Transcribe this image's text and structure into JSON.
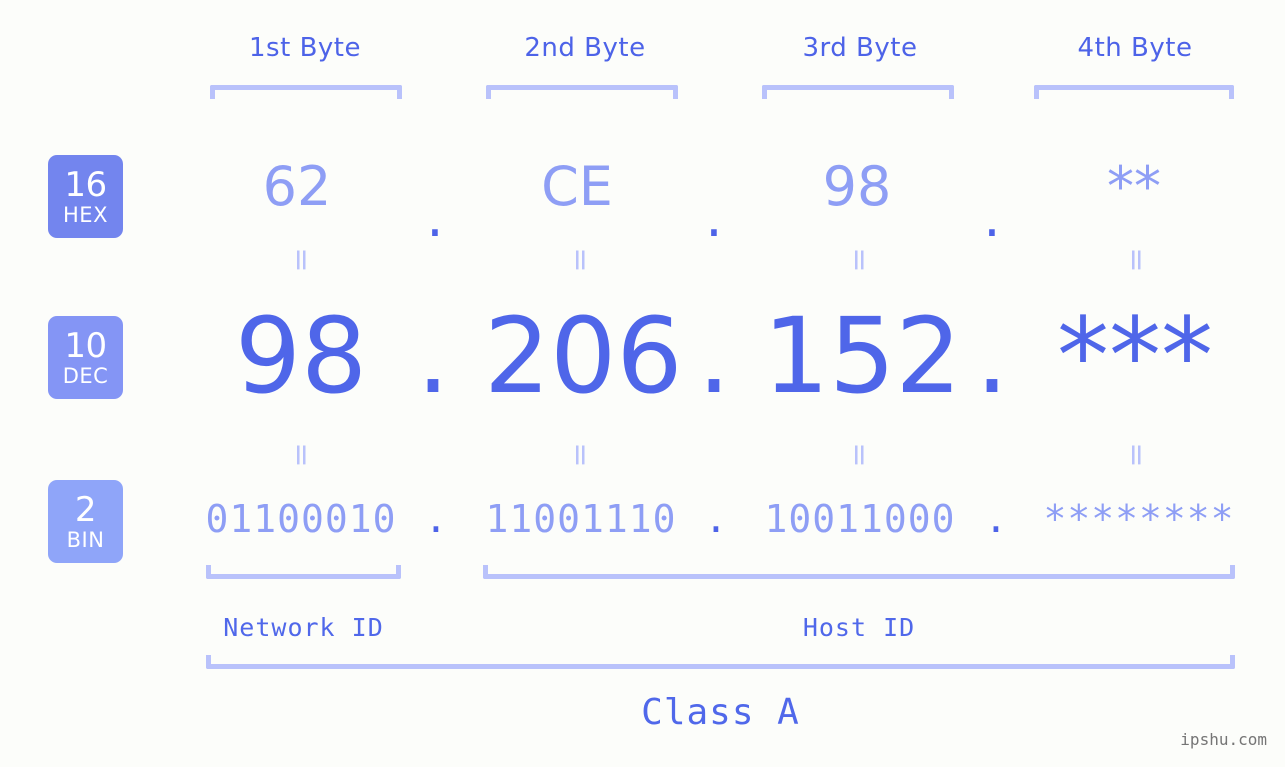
{
  "meta": {
    "background_color": "#fcfdfa",
    "accent_strong": "#4f66e9",
    "accent_light": "#8e9ef5",
    "bracket_color": "#b9c2fb",
    "watermark": "ipshu.com"
  },
  "header": {
    "byte_labels": [
      "1st Byte",
      "2nd Byte",
      "3rd Byte",
      "4th Byte"
    ]
  },
  "bases": [
    {
      "num": "16",
      "abbr": "HEX",
      "color": "#7385ee"
    },
    {
      "num": "10",
      "abbr": "DEC",
      "color": "#8495f5"
    },
    {
      "num": "2",
      "abbr": "BIN",
      "color": "#8fa5f9"
    }
  ],
  "rows": {
    "hex": {
      "octets": [
        "62",
        "CE",
        "98",
        "**"
      ],
      "separator": "."
    },
    "dec": {
      "octets": [
        "98",
        "206",
        "152",
        "***"
      ],
      "separator": "."
    },
    "bin": {
      "octets": [
        "01100010",
        "11001110",
        "10011000",
        "********"
      ],
      "separator": "."
    }
  },
  "equals_marker": "=",
  "footer": {
    "network_id_label": "Network ID",
    "host_id_label": "Host ID",
    "class_label": "Class A"
  }
}
